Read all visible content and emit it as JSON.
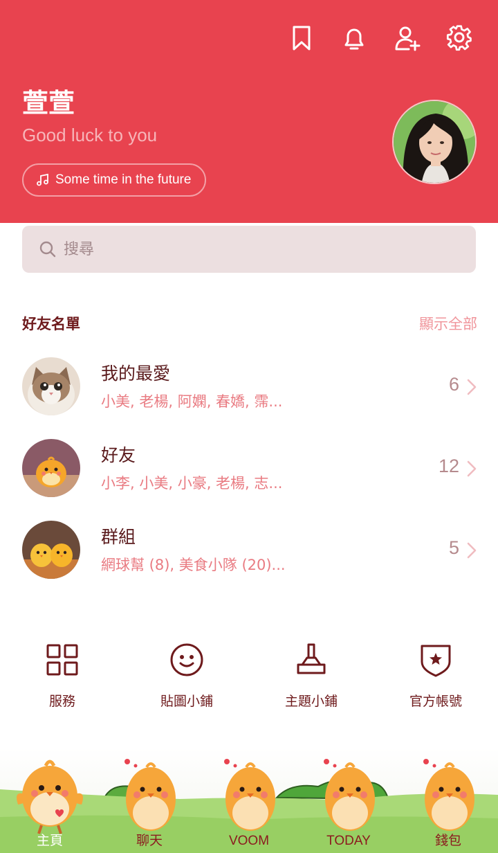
{
  "header": {
    "icons": [
      "bookmark-icon",
      "bell-icon",
      "add-friend-icon",
      "gear-icon"
    ],
    "profile_name": "萱萱",
    "status_message": "Good luck to you",
    "music_label": "Some time in the future"
  },
  "search": {
    "placeholder": "搜尋"
  },
  "friends": {
    "title": "好友名單",
    "show_all": "顯示全部",
    "groups": [
      {
        "name": "我的最愛",
        "members": "小美, 老楊, 阿嫻, 春嬌, 霈...",
        "count": "6"
      },
      {
        "name": "好友",
        "members": "小李, 小美, 小豪, 老楊, 志...",
        "count": "12"
      },
      {
        "name": "群組",
        "members": "網球幫 (8), 美食小隊 (20)...",
        "count": "5"
      }
    ]
  },
  "services": [
    {
      "label": "服務",
      "icon": "grid-icon"
    },
    {
      "label": "貼圖小鋪",
      "icon": "smiley-icon"
    },
    {
      "label": "主題小鋪",
      "icon": "brush-icon"
    },
    {
      "label": "官方帳號",
      "icon": "shield-star-icon"
    }
  ],
  "tabs": [
    {
      "label": "主頁",
      "active": true
    },
    {
      "label": "聊天"
    },
    {
      "label": "VOOM"
    },
    {
      "label": "TODAY"
    },
    {
      "label": "錢包"
    }
  ],
  "colors": {
    "header_bg": "#e8434f",
    "accent": "#e97b82",
    "text_dark": "#5a1a1c",
    "search_bg": "#ecdfe0"
  }
}
